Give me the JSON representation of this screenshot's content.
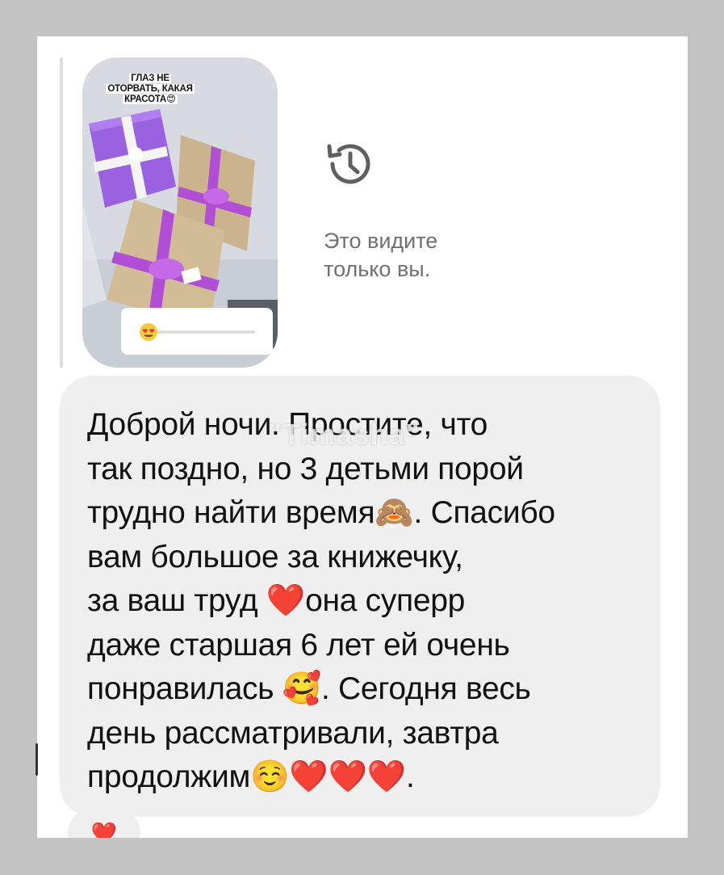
{
  "story_reply": {
    "caption": [
      "ГЛАЗ НЕ",
      "ОТОРВАТЬ, КАКАЯ",
      "КРАСОТА😍"
    ],
    "slider_emoji": "😍",
    "slider_value": 0.0
  },
  "visibility": {
    "icon": "history-icon",
    "text": "Это видите\nтолько вы."
  },
  "message": {
    "text": "Доброй ночи. Простите, что\nтак поздно, но 3 детьми порой\nтрудно найти время🙈. Спасибо\nвам большое за книжечку,\nза ваш труд ❤️она суперр\nдаже старшая 6 лет ей очень\nпонравилась 🥰. Сегодня весь\nдень рассматривали, завтра\nпродолжим☺️❤️❤️❤️.",
    "watermark": "\"Timasha\""
  },
  "reaction": {
    "emoji": "❤️"
  },
  "colors": {
    "background": "#c3c3c3",
    "bubble": "#efefef",
    "secondary_text": "#707070",
    "ribbon_purple": "#b04fd6",
    "towel_purple": "#9a62e0"
  }
}
